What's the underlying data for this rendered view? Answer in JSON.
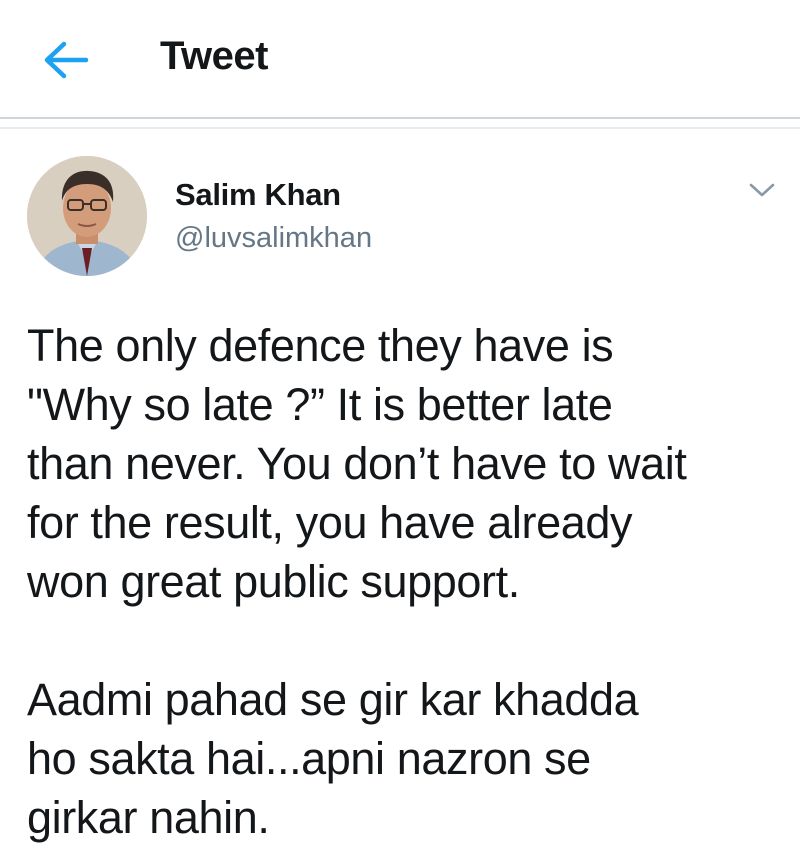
{
  "header": {
    "back_icon": "arrow-left-icon",
    "title": "Tweet",
    "accent_color": "#1da1f2"
  },
  "tweet": {
    "author_name": "Salim Khan",
    "author_handle": "@luvsalimkhan",
    "menu_icon": "chevron-down-icon",
    "paragraph_1": [
      "The only defence they have is",
      "\"Why so late ?” It is better late",
      "than never. You don’t have to wait",
      "for the result, you have already",
      "won great public support."
    ],
    "paragraph_2": [
      "Aadmi pahad se gir kar khadda",
      "ho sakta hai...apni nazron se",
      "girkar nahin."
    ]
  }
}
